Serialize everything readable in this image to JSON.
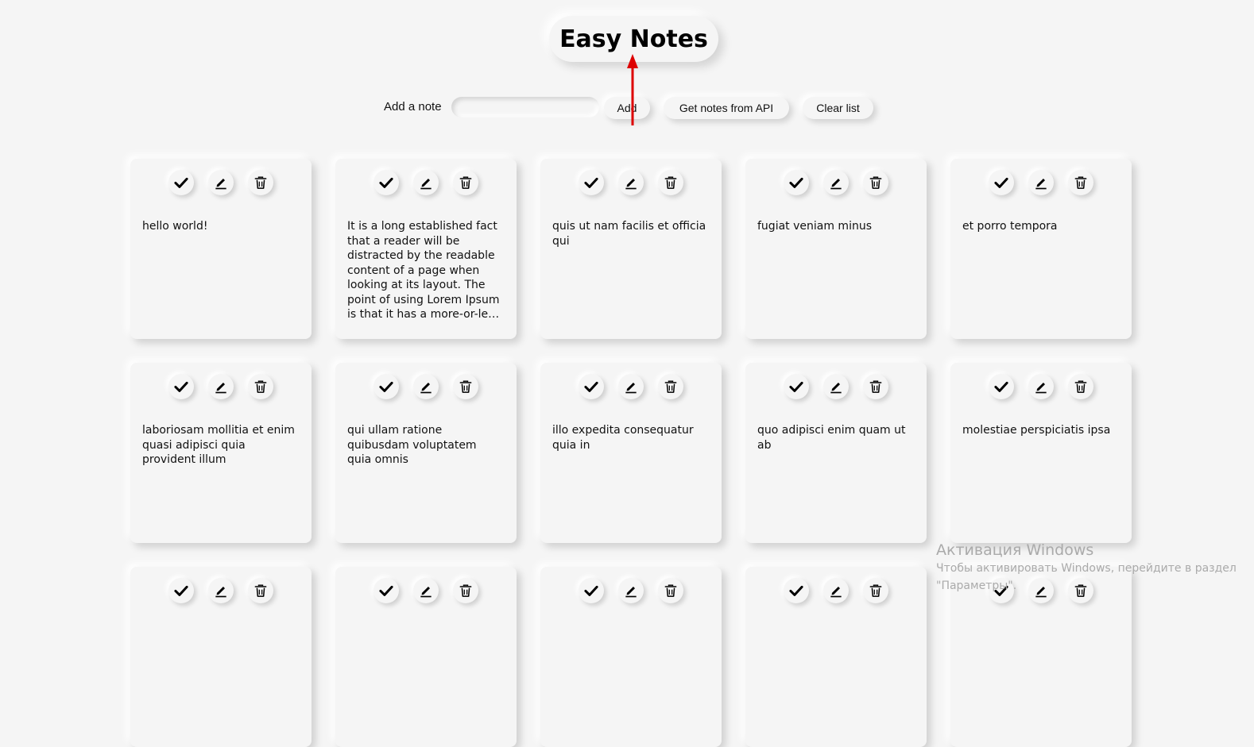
{
  "header": {
    "title": "Easy Notes"
  },
  "toolbar": {
    "add_label": "Add a note",
    "input_value": "",
    "add_button": "Add",
    "api_button": "Get notes from API",
    "clear_button": "Clear list"
  },
  "note_actions": {
    "icons": [
      "check-icon",
      "pencil-icon",
      "trash-icon"
    ]
  },
  "notes": [
    {
      "text": "hello world!"
    },
    {
      "text": "It is a long established fact that a reader will be distracted by the readable content of a page when looking at its layout. The point of using Lorem Ipsum is that it has a more-or-less normal distribution of letters"
    },
    {
      "text": "quis ut nam facilis et officia qui"
    },
    {
      "text": "fugiat veniam minus"
    },
    {
      "text": "et porro tempora"
    },
    {
      "text": "laboriosam mollitia et enim quasi adipisci quia provident illum"
    },
    {
      "text": "qui ullam ratione quibusdam voluptatem quia omnis"
    },
    {
      "text": "illo expedita consequatur quia in"
    },
    {
      "text": "quo adipisci enim quam ut ab"
    },
    {
      "text": "molestiae perspiciatis ipsa"
    },
    {
      "text": ""
    },
    {
      "text": ""
    },
    {
      "text": ""
    },
    {
      "text": ""
    },
    {
      "text": ""
    }
  ],
  "watermark": {
    "title": "Активация Windows",
    "subtitle_line1": "Чтобы активировать Windows, перейдите в раздел",
    "subtitle_line2": "\"Параметры\"."
  },
  "colors": {
    "background": "#f5f5f5",
    "arrow": "#dd0000",
    "text": "#111111"
  }
}
